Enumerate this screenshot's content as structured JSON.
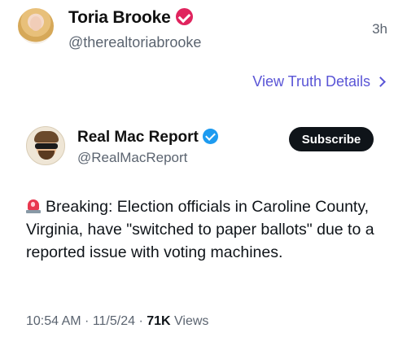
{
  "post": {
    "author_name": "Toria Brooke",
    "author_handle": "@therealtoriabrooke",
    "time_ago": "3h",
    "details_link": "View Truth Details"
  },
  "embed": {
    "author_name": "Real Mac Report",
    "author_handle": "@RealMacReport",
    "subscribe_label": "Subscribe",
    "body_text": "Breaking: Election officials in Caroline County, Virginia, have \"switched to paper ballots\" due to a reported issue with voting machines.",
    "timestamp": "10:54 AM · 11/5/24 · ",
    "views_count": "71K",
    "views_label": " Views"
  },
  "colors": {
    "link": "#5a55d6",
    "verified_red": "#e0245e",
    "verified_blue": "#1d9bf0",
    "muted_text": "#5b6470"
  },
  "icons": [
    "verified-badge-icon",
    "chevron-right-icon",
    "siren-icon"
  ]
}
